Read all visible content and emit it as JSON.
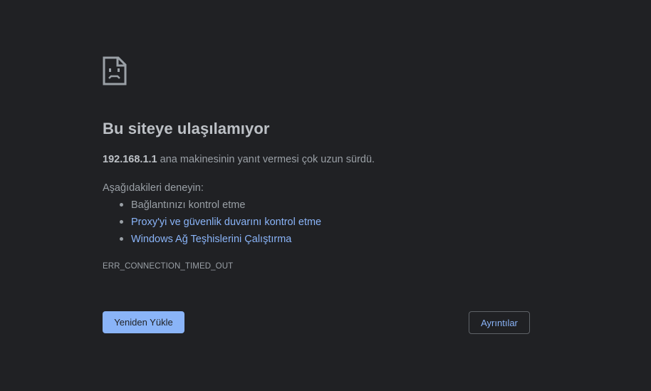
{
  "error_page": {
    "icon": "sad-page-icon",
    "title": "Bu siteye ulaşılamıyor",
    "host": "192.168.1.1",
    "description_suffix": "ana makinesinin yanıt vermesi çok uzun sürdü.",
    "try_label": "Aşağıdakileri deneyin:",
    "suggestions": [
      {
        "label": "Bağlantınızı kontrol etme"
      },
      {
        "label": "Proxy'yi ve güvenlik duvarını kontrol etme"
      },
      {
        "label": "Windows Ağ Teşhislerini Çalıştırma"
      }
    ],
    "error_code": "ERR_CONNECTION_TIMED_OUT",
    "reload_label": "Yeniden Yükle",
    "details_label": "Ayrıntılar"
  },
  "colors": {
    "background": "#202124",
    "title": "#bdc1c6",
    "text": "#9aa0a6",
    "link": "#8ab4f8",
    "button_bg": "#8ab4f8",
    "button_text": "#202124",
    "outline": "#5f6368"
  }
}
